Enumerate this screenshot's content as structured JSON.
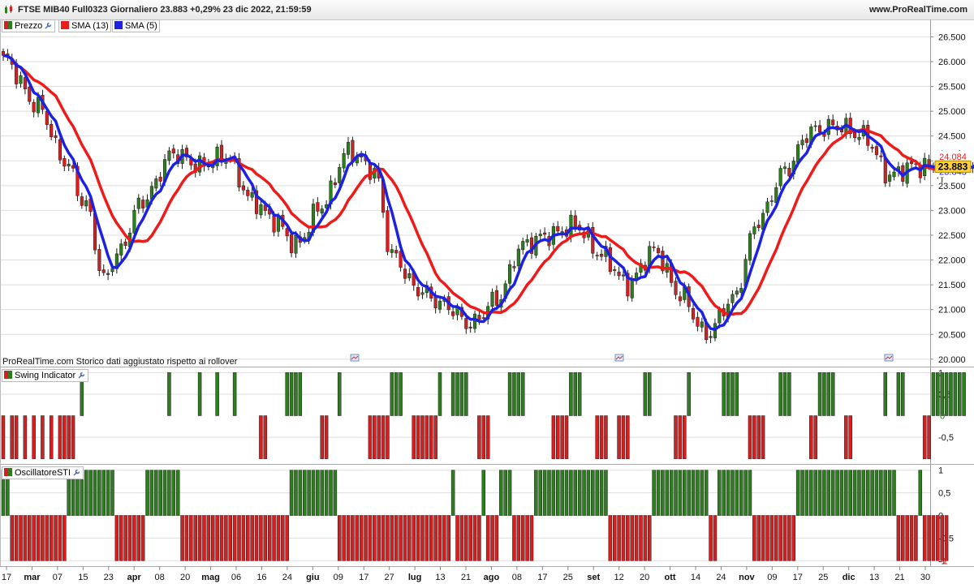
{
  "header": {
    "title": "FTSE MIB40 Full0323 Giornaliero 23.883 +0,29% 23 dic 2022, 21:59:59",
    "site": "www.ProRealTime.com"
  },
  "footer_note": "ProRealTime.com  Storico dati aggiustato rispetto ai rollover",
  "price_panel": {
    "legend": {
      "price": "Prezzo",
      "sma13": "SMA (13)",
      "sma5": "SMA (5)"
    },
    "last_price": "23.883",
    "sma13_value": "24.084",
    "sma5_value": "23.843"
  },
  "swing_panel": {
    "title": "Swing Indicator",
    "current_value": "0"
  },
  "sti_panel": {
    "title": "OscillatoreSTI",
    "current_value": "-1"
  },
  "colors": {
    "up": "#2e7d1e",
    "down": "#d42020",
    "sma13": "#ee1b1b",
    "sma5": "#1c22e0",
    "grid": "#dddddd"
  },
  "chart_data": [
    {
      "type": "candlestick",
      "series": [
        {
          "name": "Prezzo",
          "kind": "ohlc"
        },
        {
          "name": "SMA (13)",
          "kind": "line"
        },
        {
          "name": "SMA (5)",
          "kind": "line"
        }
      ],
      "ylim": [
        19850,
        26850
      ],
      "y_ticks": [
        "20.000",
        "20.500",
        "21.000",
        "21.500",
        "22.000",
        "22.500",
        "23.000",
        "23.500",
        "24.000",
        "24.500",
        "25.000",
        "25.500",
        "26.000",
        "26.500"
      ],
      "x_labels": [
        "17",
        "mar",
        "07",
        "15",
        "23",
        "apr",
        "08",
        "20",
        "mag",
        "06",
        "16",
        "24",
        "giu",
        "09",
        "17",
        "27",
        "lug",
        "13",
        "21",
        "ago",
        "08",
        "17",
        "25",
        "set",
        "12",
        "20",
        "ott",
        "14",
        "24",
        "nov",
        "09",
        "17",
        "25",
        "dic",
        "13",
        "21",
        "30"
      ],
      "close_anchors": [
        [
          0,
          26050
        ],
        [
          8,
          25100
        ],
        [
          14,
          24000
        ],
        [
          19,
          23100
        ],
        [
          23,
          21600
        ],
        [
          26,
          22100
        ],
        [
          32,
          23200
        ],
        [
          39,
          24150
        ],
        [
          45,
          23900
        ],
        [
          51,
          24100
        ],
        [
          57,
          23200
        ],
        [
          62,
          22800
        ],
        [
          67,
          22300
        ],
        [
          73,
          23100
        ],
        [
          79,
          24200
        ],
        [
          85,
          23800
        ],
        [
          89,
          22100
        ],
        [
          95,
          21400
        ],
        [
          101,
          21100
        ],
        [
          107,
          20700
        ],
        [
          113,
          21200
        ],
        [
          119,
          22300
        ],
        [
          125,
          22500
        ],
        [
          131,
          22700
        ],
        [
          137,
          22100
        ],
        [
          143,
          21500
        ],
        [
          149,
          22200
        ],
        [
          155,
          21300
        ],
        [
          161,
          20500
        ],
        [
          167,
          21200
        ],
        [
          173,
          22800
        ],
        [
          179,
          23800
        ],
        [
          185,
          24600
        ],
        [
          191,
          24700
        ],
        [
          197,
          24500
        ],
        [
          203,
          23700
        ],
        [
          208,
          23883
        ]
      ],
      "sma13_last": 24084,
      "sma5_last": 23843
    },
    {
      "type": "bar",
      "name": "Swing Indicator",
      "ylim": [
        -1,
        1
      ],
      "y_ticks": [
        "1",
        "0,5",
        "-0,5"
      ],
      "values": [
        -1,
        0,
        -1,
        -1,
        0,
        -1,
        0,
        -1,
        0,
        -1,
        0,
        -1,
        0,
        -1,
        -1,
        -1,
        -1,
        0,
        1,
        0,
        0,
        0,
        0,
        0,
        0,
        0,
        0,
        0,
        0,
        0,
        0,
        0,
        0,
        0,
        0,
        0,
        0,
        0,
        1,
        0,
        0,
        0,
        0,
        0,
        0,
        1,
        0,
        0,
        0,
        1,
        0,
        0,
        0,
        1,
        0,
        0,
        0,
        0,
        0,
        -1,
        -1,
        0,
        0,
        0,
        0,
        1,
        1,
        1,
        1,
        0,
        0,
        0,
        0,
        -1,
        -1,
        0,
        0,
        1,
        0,
        0,
        0,
        0,
        0,
        0,
        -1,
        -1,
        -1,
        -1,
        -1,
        1,
        1,
        1,
        0,
        0,
        -1,
        -1,
        -1,
        -1,
        -1,
        -1,
        1,
        0,
        0,
        1,
        1,
        1,
        1,
        0,
        0,
        -1,
        -1,
        -1,
        0,
        0,
        0,
        0,
        1,
        1,
        1,
        1,
        0,
        0,
        0,
        0,
        0,
        0,
        -1,
        -1,
        -1,
        -1,
        1,
        1,
        1,
        0,
        0,
        0,
        -1,
        -1,
        -1,
        0,
        0,
        -1,
        -1,
        -1,
        0,
        0,
        0,
        1,
        1,
        0,
        0,
        0,
        0,
        0,
        -1,
        -1,
        -1,
        1,
        0,
        0,
        0,
        0,
        0,
        0,
        0,
        1,
        1,
        1,
        1,
        0,
        0,
        -1,
        -1,
        -1,
        -1,
        0,
        0,
        0,
        1,
        1,
        1,
        0,
        0,
        0,
        0,
        -1,
        -1,
        1,
        1,
        1,
        1,
        0,
        0,
        -1,
        -1,
        0,
        0,
        0,
        0,
        0,
        0,
        0,
        1,
        0,
        0,
        1,
        1,
        0,
        0,
        0,
        0,
        -1,
        -1,
        1,
        1,
        1,
        1,
        1,
        1,
        1,
        1,
        0,
        0,
        0,
        0,
        0,
        1,
        1,
        1,
        1,
        0,
        0,
        0,
        0,
        -1,
        1,
        1,
        1,
        1,
        1,
        1,
        1,
        1,
        1,
        1,
        1,
        0,
        0,
        0,
        0,
        -1,
        -1,
        0,
        0,
        1,
        0,
        0,
        0,
        0,
        0,
        -1,
        -1,
        1,
        0,
        0,
        0,
        0,
        0,
        0,
        1,
        1,
        1,
        0,
        0,
        0,
        0,
        1,
        1,
        -1,
        -1,
        -1,
        0,
        0,
        1,
        0,
        0,
        0,
        1,
        0,
        0,
        -1,
        -1,
        0,
        0,
        0,
        0,
        1,
        1,
        1,
        1,
        1,
        0,
        0,
        0,
        0,
        0,
        1,
        1,
        1,
        1,
        1,
        1,
        0,
        0,
        0,
        0,
        0,
        0,
        -1,
        -1,
        1,
        1,
        0,
        0,
        0,
        0,
        0,
        0,
        -1,
        1,
        1,
        1,
        1,
        1,
        1,
        1,
        1,
        1,
        1,
        1,
        1,
        1,
        1,
        1,
        0,
        0,
        0,
        0,
        -1,
        0,
        1,
        1,
        0,
        0,
        0,
        0,
        0,
        0,
        1,
        1,
        0,
        0,
        0,
        0,
        1,
        1,
        0,
        0,
        0,
        0,
        0,
        0,
        1,
        0,
        0,
        0,
        0,
        0,
        0,
        0,
        0,
        0,
        0,
        0,
        0,
        -1,
        -1,
        1,
        1,
        1,
        0,
        0,
        0,
        0,
        0,
        -1,
        0,
        1
      ]
    },
    {
      "type": "bar",
      "name": "OscillatoreSTI",
      "ylim": [
        -1,
        1
      ],
      "y_ticks": [
        "1",
        "0,5",
        "0",
        "-0,5",
        "-1"
      ],
      "runs": [
        [
          1,
          2
        ],
        [
          -1,
          13
        ],
        [
          1,
          11
        ],
        [
          -1,
          7
        ],
        [
          1,
          8
        ],
        [
          -1,
          25
        ],
        [
          1,
          11
        ],
        [
          -1,
          26
        ],
        [
          1,
          1
        ],
        [
          -1,
          6
        ],
        [
          1,
          1
        ],
        [
          -1,
          3
        ],
        [
          1,
          3
        ],
        [
          -1,
          5
        ],
        [
          1,
          17
        ],
        [
          -1,
          10
        ],
        [
          1,
          13
        ],
        [
          -1,
          2
        ],
        [
          1,
          8
        ],
        [
          -1,
          10
        ],
        [
          1,
          23
        ],
        [
          -1,
          5
        ],
        [
          1,
          1
        ],
        [
          -1,
          6
        ]
      ]
    }
  ]
}
